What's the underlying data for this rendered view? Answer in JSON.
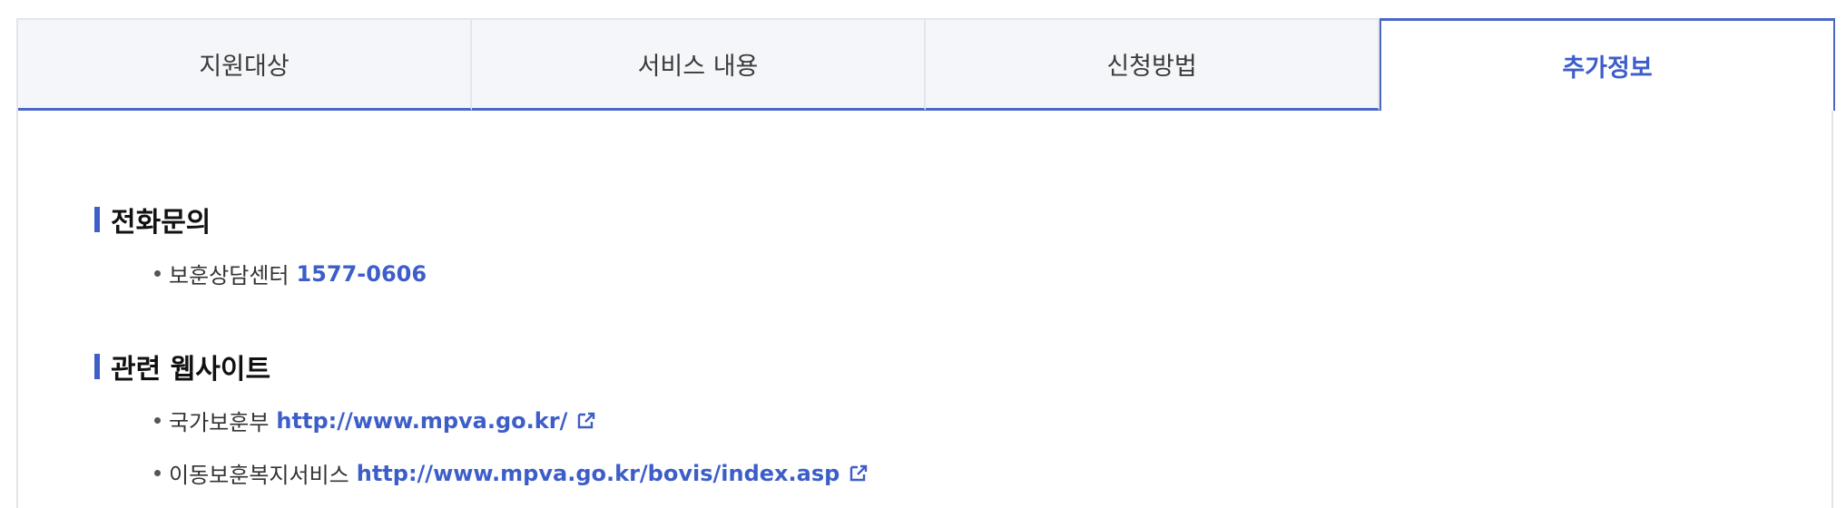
{
  "tabs": [
    {
      "label": "지원대상"
    },
    {
      "label": "서비스 내용"
    },
    {
      "label": "신청방법"
    },
    {
      "label": "추가정보",
      "active": true
    }
  ],
  "phone_section": {
    "title": "전화문의",
    "items": [
      {
        "label": "보훈상담센터",
        "value": "1577-0606"
      }
    ]
  },
  "website_section": {
    "title": "관련 웹사이트",
    "items": [
      {
        "label": "국가보훈부",
        "url": "http://www.mpva.go.kr/",
        "icon": "external-link-icon"
      },
      {
        "label": "이동보훈복지서비스",
        "url": "http://www.mpva.go.kr/bovis/index.asp",
        "icon": "external-link-icon"
      }
    ]
  },
  "colors": {
    "accent": "#3d5ec9",
    "tab_border": "#4a67c8",
    "tab_bg": "#f5f6f9"
  }
}
